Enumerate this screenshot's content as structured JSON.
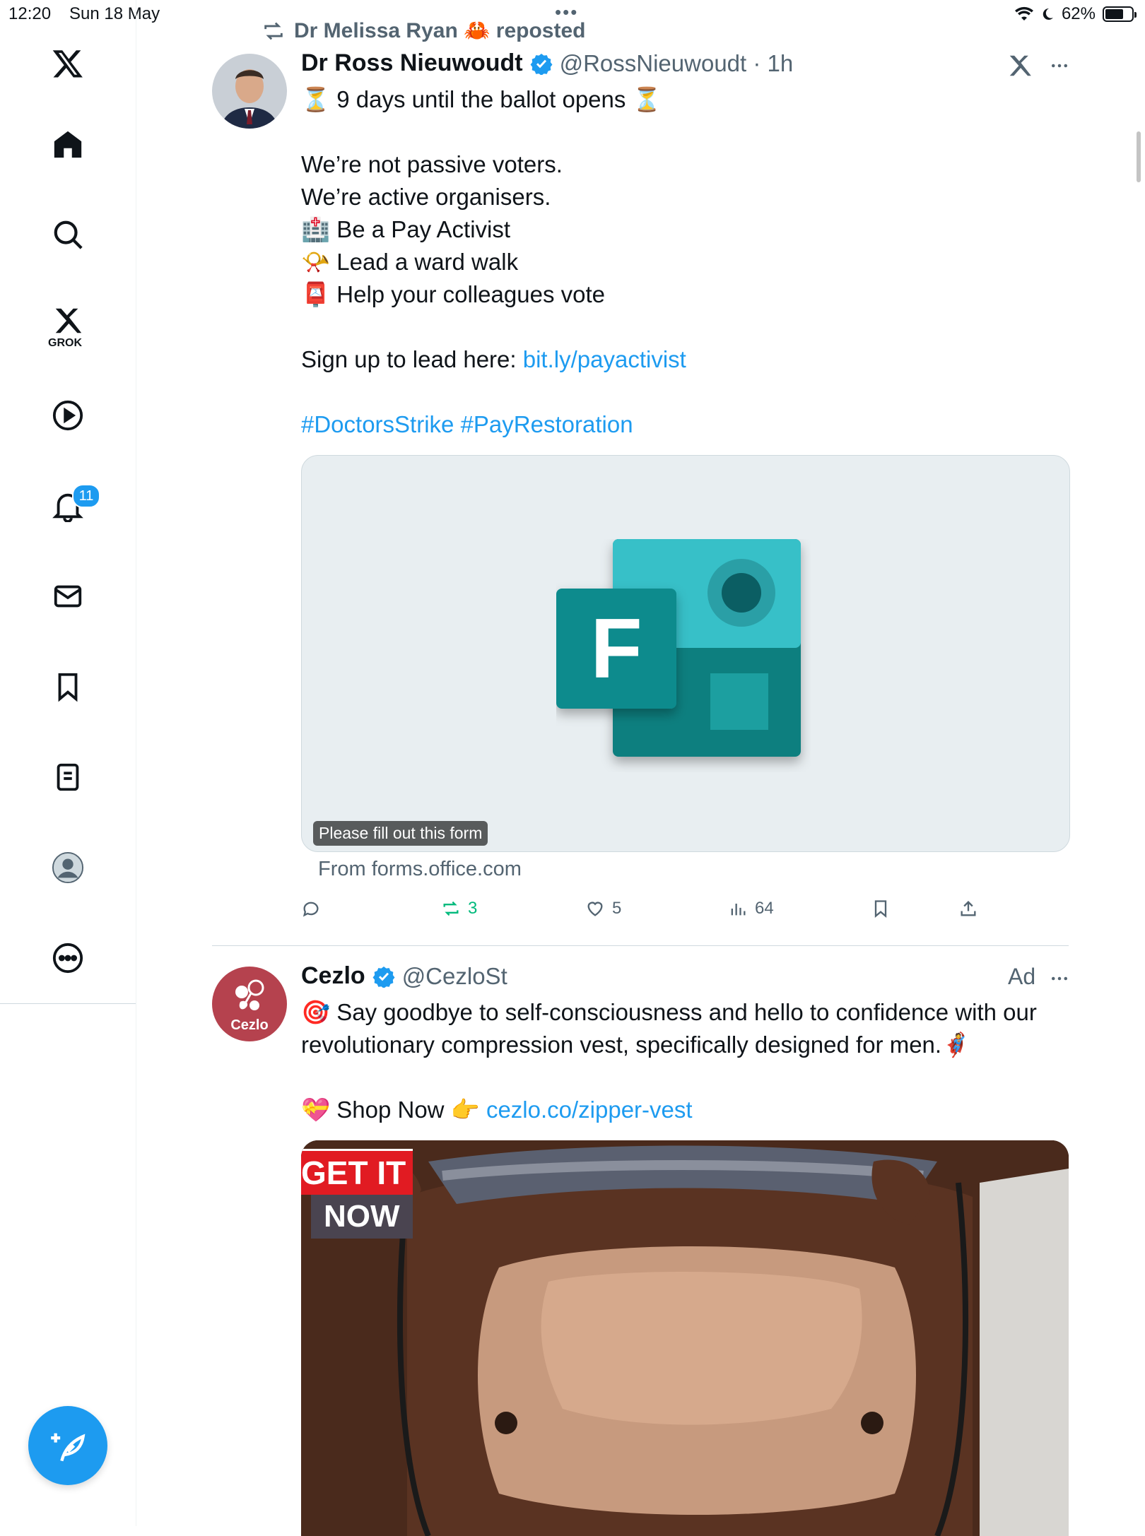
{
  "status_bar": {
    "time": "12:20",
    "date": "Sun 18 May",
    "battery": "62%",
    "battery_level": 0.62
  },
  "sidebar": {
    "grok_label": "GROK",
    "notification_count": "11"
  },
  "tweet1": {
    "repost_label": "Dr Melissa Ryan 🦀 reposted",
    "author_name": "Dr Ross Nieuwoudt",
    "handle_time": "@RossNieuwoudt · 1h",
    "line1": "⏳ 9 days until the ballot opens ⏳",
    "line2": "We’re not passive voters.",
    "line3": "We’re active organisers.",
    "line4": "🏥 Be a Pay Activist",
    "line5": "📯 Lead a ward walk",
    "line6": "📮 Help your colleagues vote",
    "signup_text": "Sign up to lead here: ",
    "signup_link": "bit.ly/payactivist",
    "hashtags": "#DoctorsStrike #PayRestoration",
    "card_caption": "Please fill out this form",
    "card_source": "From forms.office.com",
    "retweets": "3",
    "likes": "5",
    "views": "64"
  },
  "tweet2": {
    "author_name": "Cezlo",
    "handle": "@CezloSt",
    "ad_label": "Ad",
    "avatar_text": "Cezlo",
    "text_line1": "🎯 Say goodbye to self-consciousness and hello to confidence with our",
    "text_line2": "revolutionary compression vest, specifically designed for men.🦸",
    "shop_text": "💝 Shop Now 👉 ",
    "shop_link": "cezlo.co/zipper-vest",
    "banner_line1": "GET IT",
    "banner_line2": "NOW"
  }
}
